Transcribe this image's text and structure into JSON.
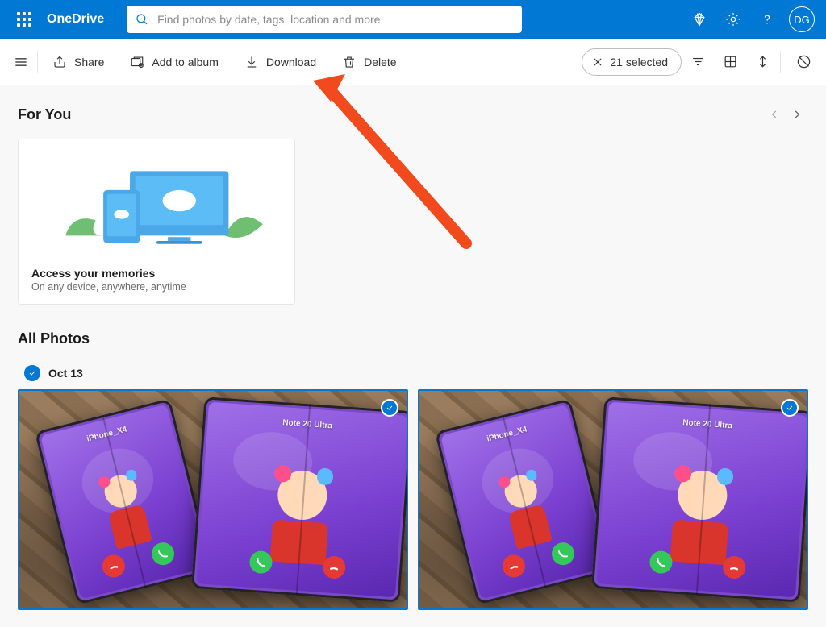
{
  "header": {
    "brand": "OneDrive",
    "search_placeholder": "Find photos by date, tags, location and more",
    "avatar_initials": "DG"
  },
  "commandbar": {
    "share": "Share",
    "add_to_album": "Add to album",
    "download": "Download",
    "delete": "Delete",
    "selected_count": "21 selected"
  },
  "for_you": {
    "title": "For You",
    "card_title": "Access your memories",
    "card_subtitle": "On any device, anywhere, anytime"
  },
  "all_photos": {
    "title": "All Photos",
    "groups": [
      {
        "date_label": "Oct 13",
        "photos": [
          {
            "selected": true,
            "caller_left": "iPhone_X4",
            "caller_right": "Note 20 Ultra"
          },
          {
            "selected": true,
            "caller_left": "iPhone_X4",
            "caller_right": "Note 20 Ultra"
          }
        ]
      }
    ]
  },
  "colors": {
    "brand_blue": "#0078d4",
    "arrow_red": "#f24a1d"
  }
}
